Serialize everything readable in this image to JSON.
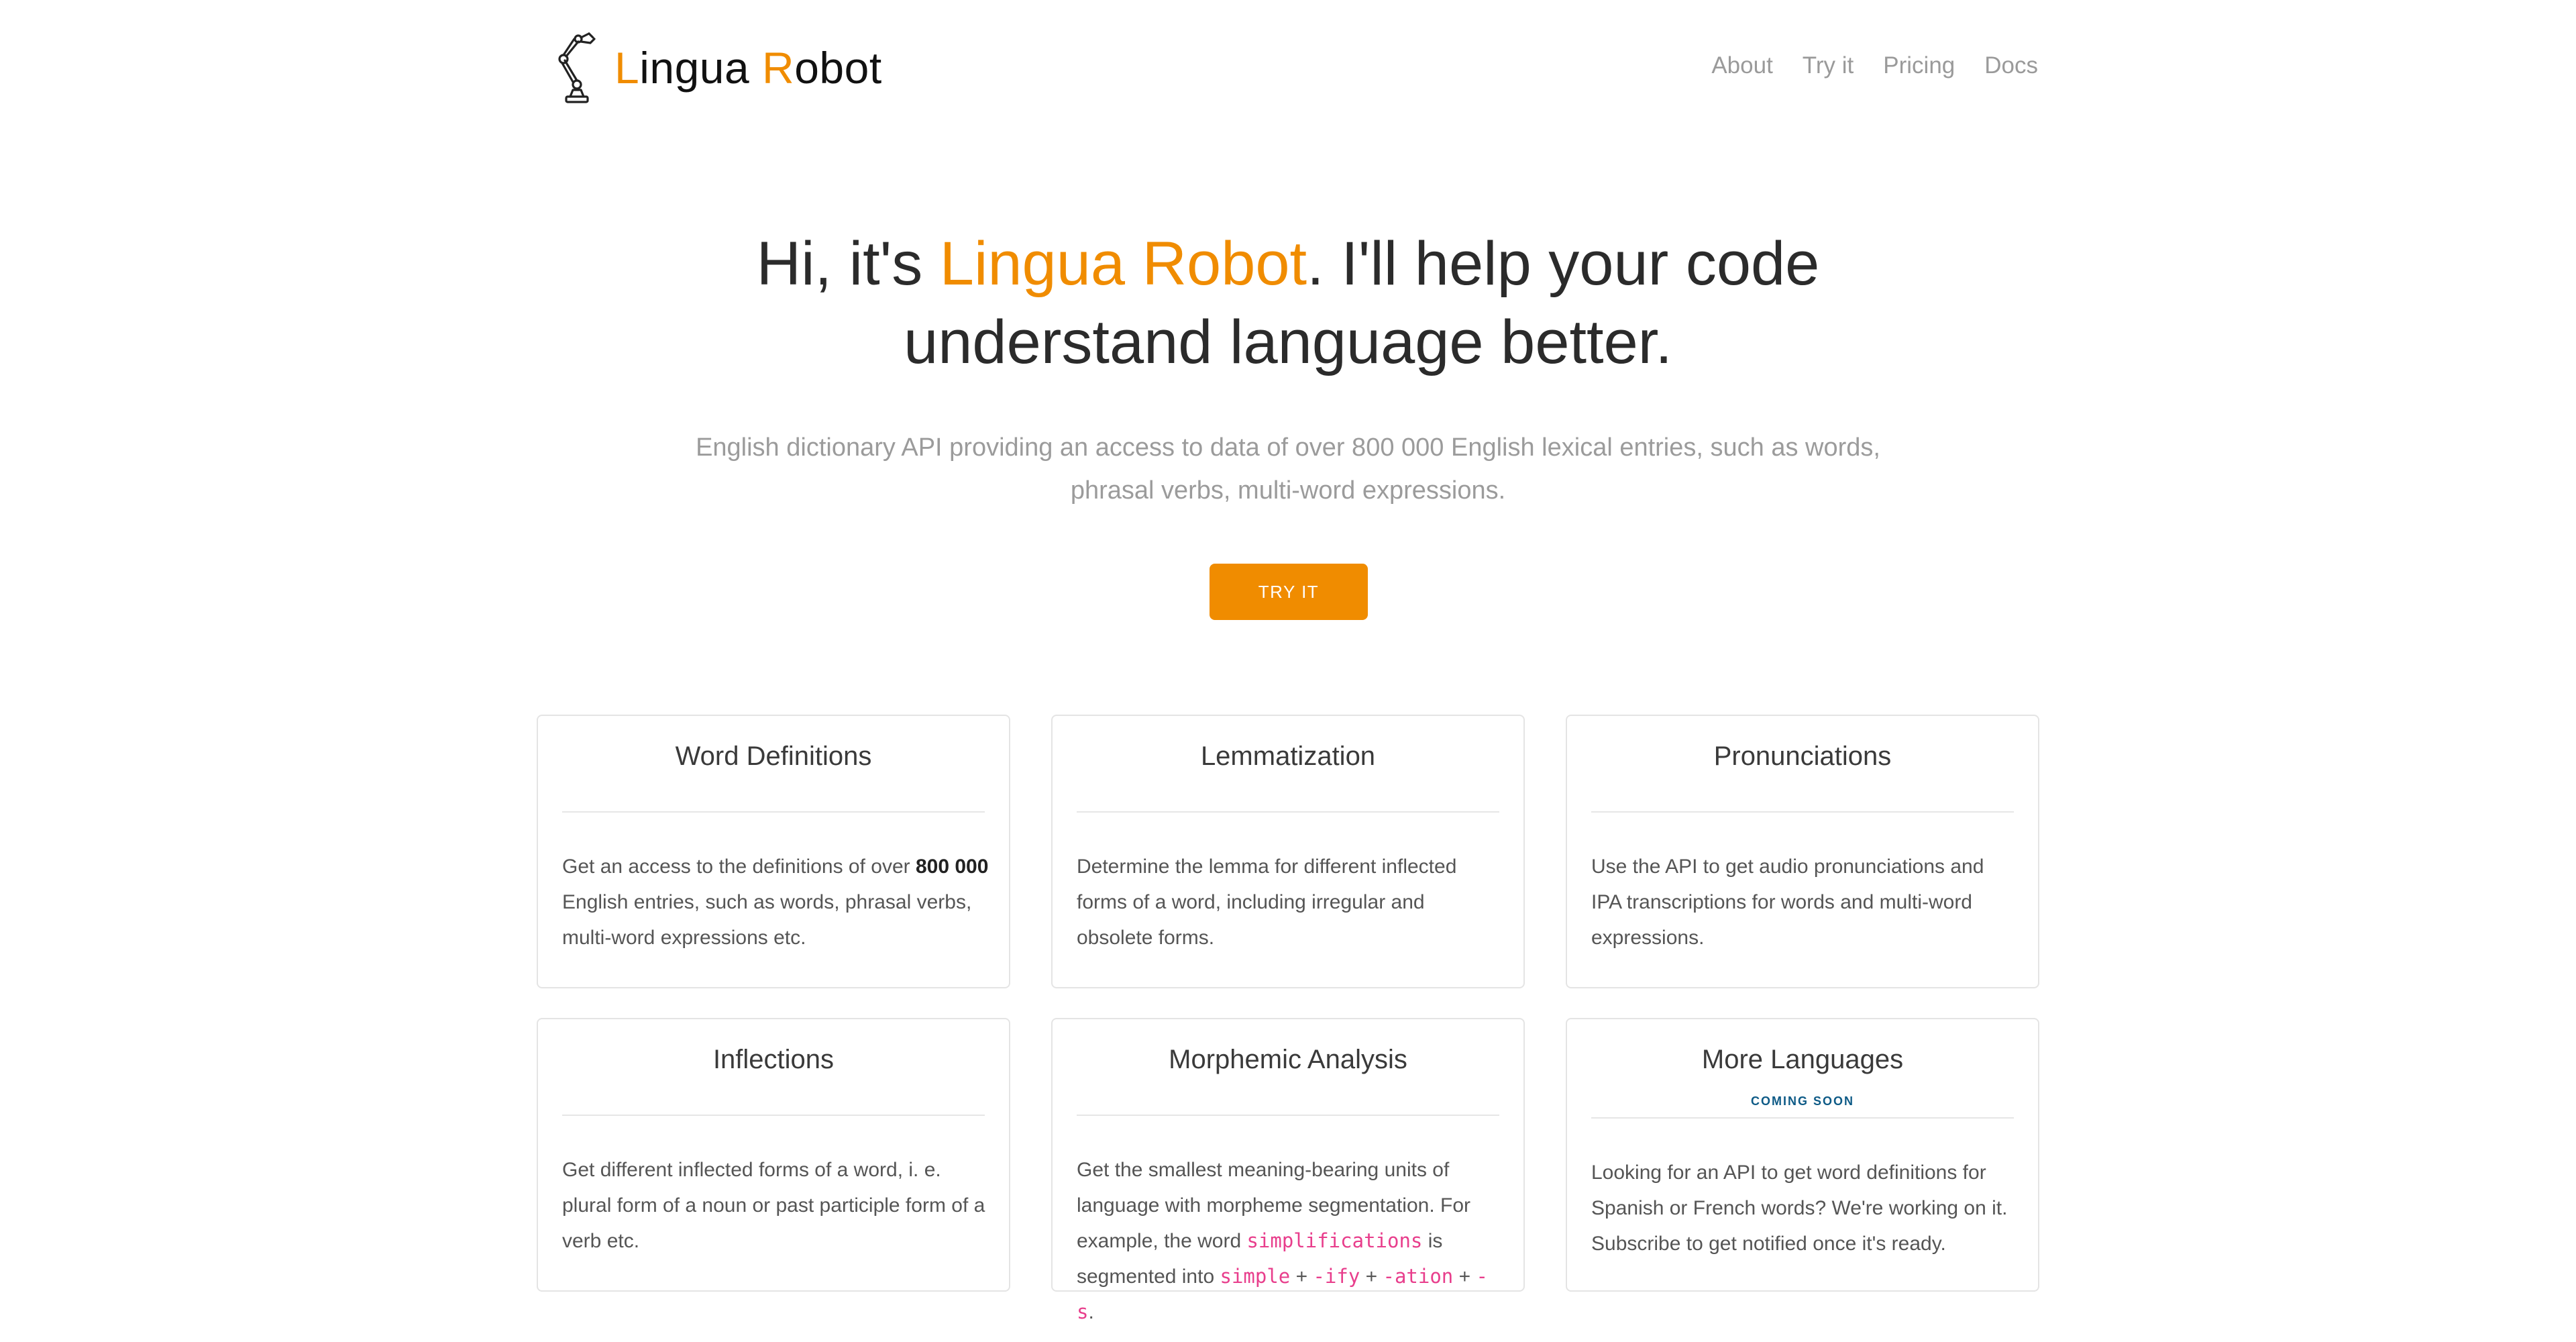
{
  "header": {
    "logo_prefix_accent": "L",
    "logo_mid": "ingua ",
    "logo_mid_accent": "R",
    "logo_suffix": "obot",
    "nav": [
      "About",
      "Try it",
      "Pricing",
      "Docs"
    ]
  },
  "hero": {
    "title_before": "Hi, it's ",
    "title_accent": "Lingua Robot",
    "title_after_line1": ". I'll help your code",
    "title_line2": "understand language better.",
    "subtitle_line1": "English dictionary API providing an access to data of over 800 000 English lexical entries, such as words,",
    "subtitle_line2": "phrasal verbs, multi-word expressions.",
    "cta_label": "TRY IT"
  },
  "cards": [
    {
      "title": "Word Definitions",
      "body_before": "Get an access to the definitions of over ",
      "body_bold": "800 000",
      "body_after": " English entries, such as words, phrasal verbs, multi-word expressions etc."
    },
    {
      "title": "Lemmatization",
      "body": "Determine the lemma for different inflected forms of a word, including irregular and obsolete forms."
    },
    {
      "title": "Pronunciations",
      "body": "Use the API to get audio pronunciations and IPA transcriptions for words and multi-word expressions."
    },
    {
      "title": "Inflections",
      "body": "Get different inflected forms of a word, i. e. plural form of a noun or past participle form of a verb etc."
    },
    {
      "title": "Morphemic Analysis",
      "body_1": "Get the smallest meaning-bearing units of language with morpheme segmentation. For example, the word ",
      "code_word": "simplifications",
      "body_2": " is segmented into ",
      "code_1": "simple",
      "plus": " + ",
      "code_2": "-ify",
      "code_3": "-ation",
      "code_4": "-s",
      "period": "."
    },
    {
      "title": "More Languages",
      "badge": "COMING SOON",
      "body": "Looking for an API to get word definitions for Spanish or French words? We're working on it. Subscribe to get notified once it's ready."
    }
  ],
  "colors": {
    "accent": "#f08c00",
    "code": "#e83e8c",
    "badge": "#0d5a86"
  }
}
